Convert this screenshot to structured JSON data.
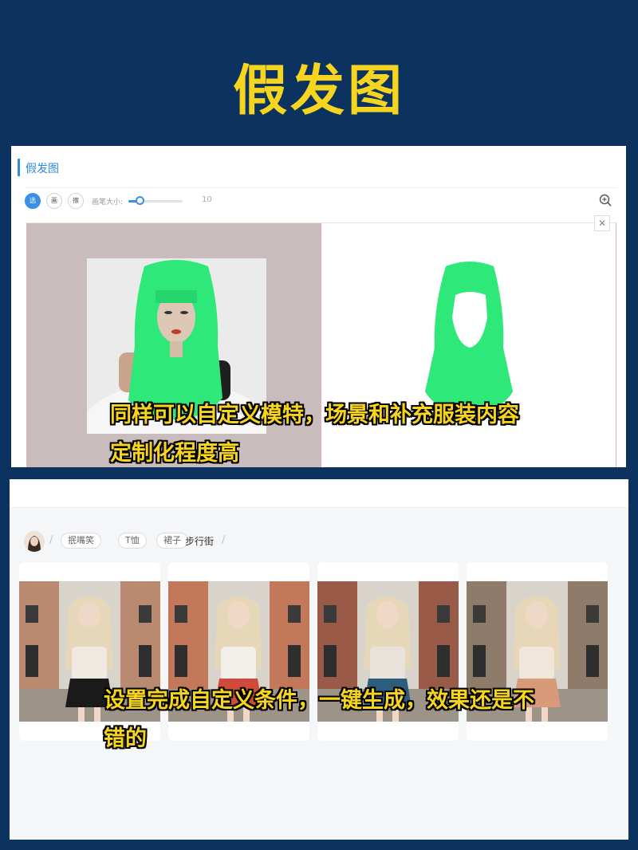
{
  "page_title": "假发图",
  "editor": {
    "title": "假发图",
    "tools": [
      "选",
      "画",
      "擦"
    ],
    "brush_label": "画笔大小:",
    "brush_value": "10",
    "brush_level_fraction": 0.2
  },
  "caption_top": {
    "line1": "同样可以自定义模特，场景和补充服装内容",
    "line2": "定制化程度高"
  },
  "results": {
    "breadcrumb": [
      "抿嘴笑",
      "T恤",
      "裙子"
    ],
    "current": "步行街",
    "cards": [
      {
        "skirt": "#1a1a1a",
        "top": "#efe9e2",
        "wall": "#b98970"
      },
      {
        "skirt": "#cf4a3a",
        "top": "#f2eee8",
        "wall": "#c4785a"
      },
      {
        "skirt": "#2d5d7c",
        "top": "#e8e2da",
        "wall": "#9a5a48"
      },
      {
        "skirt": "#d99a7a",
        "top": "#f0e6da",
        "wall": "#8f7b6a"
      }
    ]
  },
  "caption_bottom": {
    "line1": "设置完成自定义条件，一键生成，效果还是不",
    "line2": "错的"
  },
  "colors": {
    "background": "#0c3360",
    "title": "#f7d51e",
    "accent": "#2d8be0",
    "wig_green": "#2ee87a"
  }
}
